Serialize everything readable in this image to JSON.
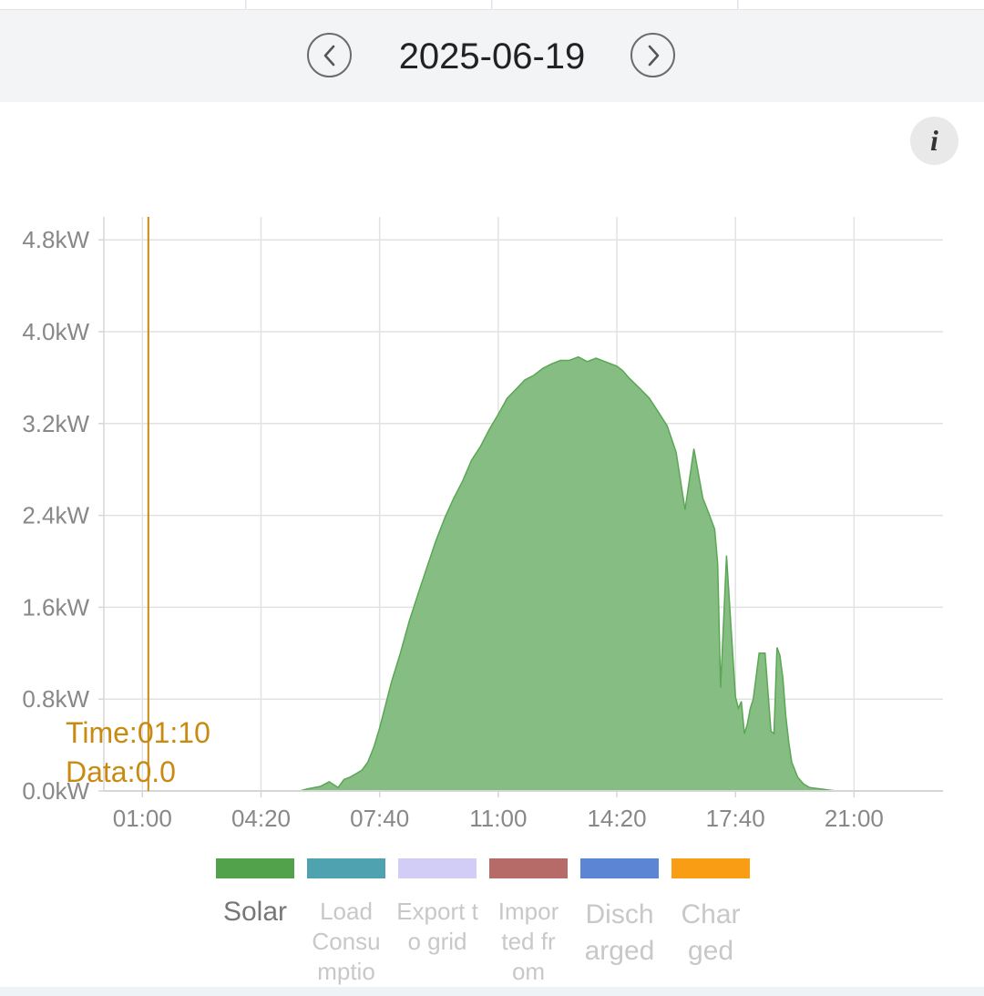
{
  "header": {
    "date": "2025-06-19",
    "prev_icon": "chevron-left-icon",
    "next_icon": "chevron-right-icon",
    "info_label": "i"
  },
  "cursor": {
    "time_text": "Time:01:10",
    "data_text": "Data:0.0",
    "time": "01:10",
    "color": "#c98a12"
  },
  "chart_data": {
    "type": "area",
    "title": "",
    "xlabel": "",
    "ylabel": "",
    "ylim": [
      0,
      5.0
    ],
    "yticks": [
      "0.0kW",
      "0.8kW",
      "1.6kW",
      "2.4kW",
      "3.2kW",
      "4.0kW",
      "4.8kW"
    ],
    "ytick_values": [
      0,
      0.8,
      1.6,
      2.4,
      3.2,
      4.0,
      4.8
    ],
    "xticks": [
      "01:00",
      "04:20",
      "07:40",
      "11:00",
      "14:20",
      "17:40",
      "21:00"
    ],
    "xlim": [
      "-00:05",
      "23:30"
    ],
    "grid": true,
    "series": [
      {
        "name": "Solar",
        "color": "#5aa755",
        "fill": "#86bd82",
        "x": [
          "00:00",
          "05:00",
          "05:25",
          "05:40",
          "06:00",
          "06:15",
          "06:30",
          "06:40",
          "06:50",
          "07:00",
          "07:10",
          "07:20",
          "07:30",
          "07:40",
          "07:50",
          "08:00",
          "08:15",
          "08:30",
          "08:45",
          "09:00",
          "09:15",
          "09:30",
          "09:45",
          "10:00",
          "10:15",
          "10:30",
          "10:45",
          "11:00",
          "11:15",
          "11:30",
          "11:45",
          "12:00",
          "12:15",
          "12:30",
          "12:45",
          "13:00",
          "13:15",
          "13:30",
          "13:45",
          "14:00",
          "14:10",
          "14:20",
          "14:30",
          "14:40",
          "14:50",
          "15:00",
          "15:15",
          "15:30",
          "15:45",
          "16:00",
          "16:15",
          "16:30",
          "16:45",
          "16:55",
          "17:05",
          "17:10",
          "17:15",
          "17:25",
          "17:40",
          "17:45",
          "17:50",
          "17:55",
          "18:00",
          "18:05",
          "18:10",
          "18:20",
          "18:30",
          "18:40",
          "18:45",
          "18:50",
          "18:55",
          "19:00",
          "19:05",
          "19:10",
          "19:15",
          "19:25",
          "19:35",
          "19:45",
          "20:00",
          "20:15",
          "20:30",
          "20:45",
          "21:00",
          "21:15",
          "21:30",
          "23:30"
        ],
        "values": [
          0.0,
          0.0,
          0.0,
          0.02,
          0.04,
          0.08,
          0.03,
          0.1,
          0.12,
          0.15,
          0.18,
          0.25,
          0.38,
          0.55,
          0.75,
          0.95,
          1.2,
          1.48,
          1.72,
          1.95,
          2.18,
          2.38,
          2.55,
          2.7,
          2.88,
          3.0,
          3.15,
          3.28,
          3.42,
          3.5,
          3.58,
          3.62,
          3.68,
          3.72,
          3.75,
          3.75,
          3.78,
          3.74,
          3.77,
          3.74,
          3.72,
          3.7,
          3.66,
          3.6,
          3.55,
          3.5,
          3.42,
          3.3,
          3.18,
          2.95,
          2.45,
          2.98,
          2.55,
          2.42,
          2.28,
          1.98,
          0.9,
          2.05,
          0.82,
          0.72,
          0.78,
          0.5,
          0.58,
          0.72,
          0.8,
          1.2,
          1.2,
          0.52,
          0.5,
          1.25,
          1.18,
          0.98,
          0.65,
          0.42,
          0.25,
          0.12,
          0.06,
          0.03,
          0.02,
          0.01,
          0.0,
          0.0,
          0.0,
          0.0,
          0.0,
          0.0
        ]
      }
    ],
    "legend": [
      {
        "label": "Solar",
        "color": "#52a24c",
        "active": true
      },
      {
        "label": "Load Consumptio",
        "color": "#4fa3b0",
        "active": false
      },
      {
        "label": "Export to grid",
        "color": "#d2cdf7",
        "active": false
      },
      {
        "label": "Imported from",
        "color": "#b66b69",
        "active": false
      },
      {
        "label": "Discharged",
        "color": "#5c86d4",
        "active": false
      },
      {
        "label": "Charged",
        "color": "#f89d14",
        "active": false
      }
    ]
  }
}
